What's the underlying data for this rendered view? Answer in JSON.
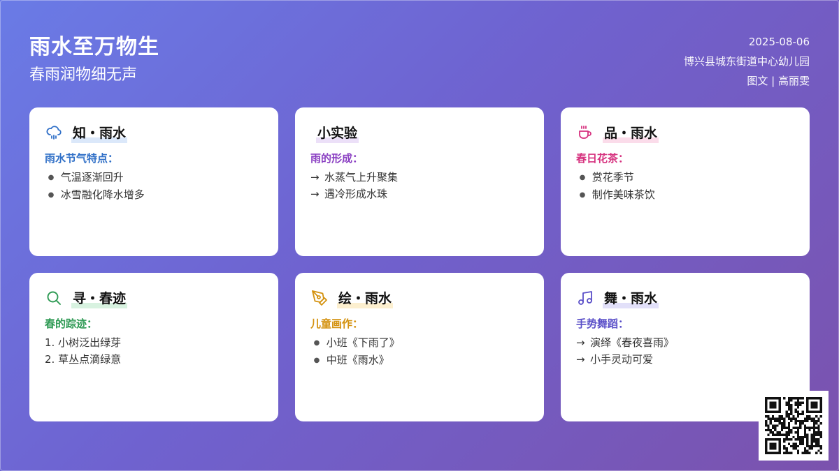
{
  "header": {
    "title": "雨水至万物生",
    "subtitle": "春雨润物细无声",
    "date": "2025-08-06",
    "org": "博兴县城东街道中心幼儿园",
    "credit": "图文 | 高丽雯"
  },
  "cards": [
    {
      "title": "知・雨水",
      "icon": "rain-cloud-icon",
      "accent": "#2f6fc7",
      "highlight": "#dbe8fa",
      "section": "雨水节气特点：",
      "items": [
        "气温逐渐回升",
        "冰雪融化降水增多"
      ]
    },
    {
      "title": "小实验",
      "icon": "",
      "accent": "#8a3fc2",
      "highlight": "#ece0f8",
      "section": "雨的形成：",
      "items": [
        "水蒸气上升聚集",
        "遇冷形成水珠"
      ]
    },
    {
      "title": "品・雨水",
      "icon": "tea-cup-icon",
      "accent": "#d6327f",
      "highlight": "#fbdcea",
      "section": "春日花茶：",
      "items": [
        "赏花季节",
        "制作美味茶饮"
      ]
    },
    {
      "title": "寻・春迹",
      "icon": "search-icon",
      "accent": "#2e9a54",
      "highlight": "#d8f2e0",
      "section": "春的踪迹：",
      "items": [
        "1. 小树泛出绿芽",
        "2. 草丛点滴绿意"
      ]
    },
    {
      "title": "绘・雨水",
      "icon": "pen-tool-icon",
      "accent": "#d4920f",
      "highlight": "#fcefcf",
      "section": "儿童画作：",
      "items": [
        "小班《下雨了》",
        "中班《雨水》"
      ]
    },
    {
      "title": "舞・雨水",
      "icon": "music-note-icon",
      "accent": "#5a4fc8",
      "highlight": "#e2e0f9",
      "section": "手势舞蹈：",
      "items": [
        "演绎《春夜喜雨》",
        "小手灵动可爱"
      ]
    }
  ]
}
